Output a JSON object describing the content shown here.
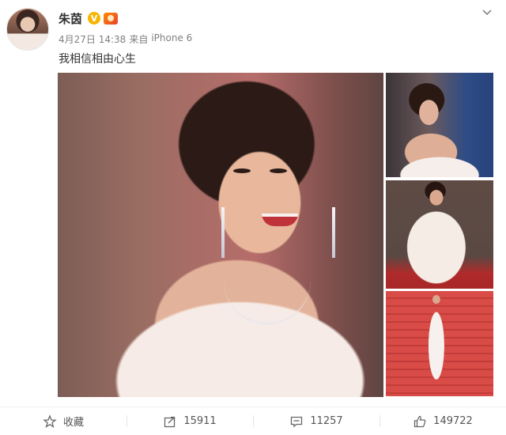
{
  "post": {
    "username": "朱茵",
    "verified_badge": "V",
    "date": "4月27日 14:38",
    "source_prefix": "来自",
    "source_device": "iPhone 6",
    "text": "我相信相由心生"
  },
  "icons": {
    "verified": "verified-badge-icon",
    "member": "member-crown-icon",
    "menu": "chevron-down-icon",
    "favorite": "star-icon",
    "repost": "share-arrow-icon",
    "comment": "comment-bubble-icon",
    "like": "thumbs-up-icon"
  },
  "actions": {
    "favorite_label": "收藏",
    "repost_count": "15911",
    "comment_count": "11257",
    "like_count": "149722"
  },
  "colors": {
    "verified": "#f7b500",
    "text_primary": "#333333",
    "text_meta": "#808080"
  }
}
